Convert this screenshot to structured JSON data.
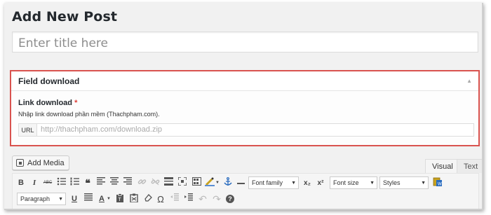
{
  "page": {
    "title": "Add New Post"
  },
  "title_field": {
    "placeholder": "Enter title here"
  },
  "metabox": {
    "title": "Field download",
    "toggle_icon": "▲",
    "field": {
      "label": "Link download",
      "required_mark": "*",
      "description": "Nhập link download phần mềm (Thachpham.com).",
      "prefix": "URL",
      "placeholder": "http://thachpham.com/download.zip"
    }
  },
  "media": {
    "add_label": "Add Media"
  },
  "tabs": {
    "visual": "Visual",
    "text": "Text"
  },
  "toolbar": {
    "bold": "B",
    "italic": "I",
    "strike": "ABC",
    "blockquote": "❝",
    "font_family": "Font family",
    "subscript": "x₂",
    "superscript": "x²",
    "font_size": "Font size",
    "styles": "Styles",
    "format": "Paragraph",
    "underline": "U",
    "text_color": "A",
    "omega": "Ω",
    "undo": "↶",
    "redo": "↷",
    "help": "?",
    "dropdown_arrow": "▼"
  },
  "colors": {
    "highlight_border": "#d9534f",
    "required": "#dd3d36"
  }
}
